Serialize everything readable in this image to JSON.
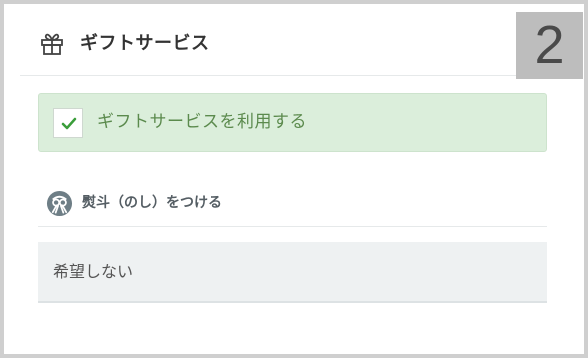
{
  "header": {
    "icon": "gift-icon",
    "title": "ギフトサービス"
  },
  "step_badge": "2",
  "gift_option": {
    "checked": true,
    "label": "ギフトサービスを利用する",
    "background_color": "#dbeedb",
    "check_color": "#3a9d3a"
  },
  "noshi": {
    "icon": "noshi-icon",
    "label": "熨斗（のし）をつける",
    "selected_value": "希望しない"
  }
}
